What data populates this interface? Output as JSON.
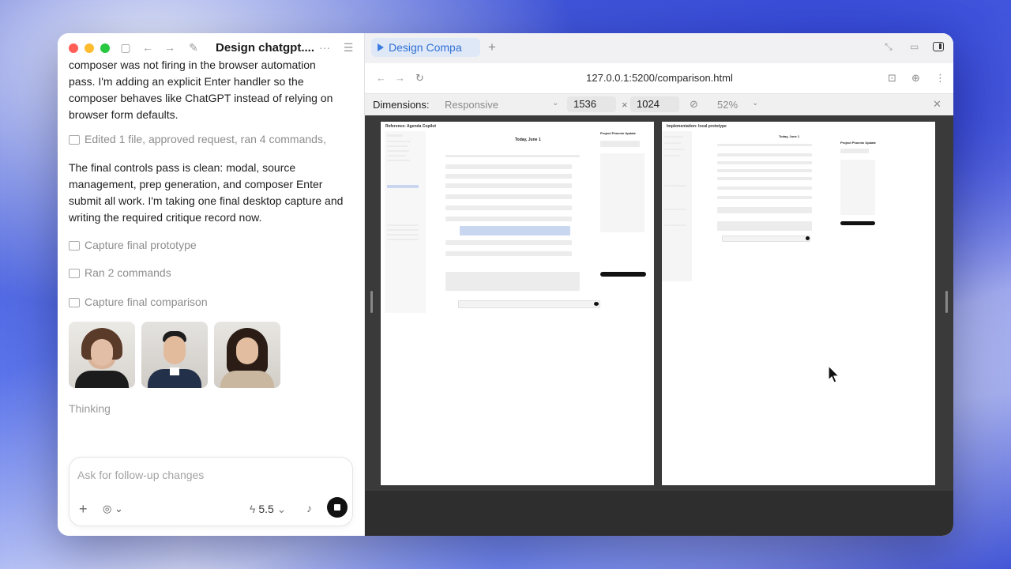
{
  "left": {
    "title": "Design chatgpt....",
    "messages": {
      "p1": "composer was not firing in the browser automation pass. I'm adding an explicit Enter handler so the composer behaves like ChatGPT instead of relying on browser form defaults.",
      "m1": "Edited 1 file, approved request, ran 4 commands,",
      "p2": "The final controls pass is clean: modal, source management, prep generation, and composer Enter submit all work. I'm taking one final desktop capture and writing the required critique record now.",
      "m2": "Capture final prototype",
      "m3": "Ran 2 commands",
      "m4": "Capture final comparison",
      "thinking": "Thinking"
    },
    "composer": {
      "placeholder": "Ask for follow-up changes",
      "model": "5.5"
    }
  },
  "right": {
    "tab_title": "Design Compa",
    "url": "127.0.0.1:5200/comparison.html",
    "dims": {
      "label": "Dimensions:",
      "mode": "Responsive",
      "width": "1536",
      "x": "×",
      "height": "1024",
      "zoom": "52%"
    },
    "panels": {
      "left_title": "Reference: Agenda Copilot",
      "right_title": "Implementation: local prototype",
      "left_heading": "Today, June 1",
      "right_heading": "Today, June 1",
      "right_card_title": "Project Phoenix Update",
      "left_card_title": "Project Phoenix Update"
    }
  },
  "colors": {
    "accent": "#2f6fd4",
    "stop": "#111111"
  }
}
